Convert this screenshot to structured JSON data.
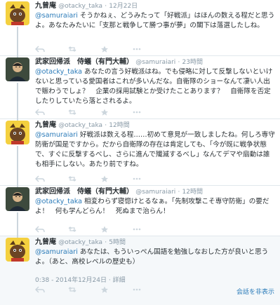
{
  "tweets": [
    {
      "name": "九曾庵",
      "screen": "@otacky_taka",
      "time": "12月22日",
      "mention": "@samuraiari",
      "text": " そうかねぇ、どうみたって「好戦派」はほんの数える程だと思うよ。あなたみたいに「支那と戦争して勝つ事が夢」の閣下は落選したしね。"
    },
    {
      "name": "武家回帰派　侍蟻（有門大輔）",
      "screen": "@samuraiari",
      "time": "23時間",
      "mention": "@otacky_taka",
      "text": " あなたの言う好戦派はね。でも侵略に対して反撃しないといけないと思っている愛国者はこれが多いんだな。自衛隊のショーなんて凄い人出で賑わうでしょ？　企業の採用試験とか受けたことあります？　自衛隊を否定したりしていたら落とされるよ。"
    },
    {
      "name": "九曾庵",
      "screen": "@otacky_taka",
      "time": "12時間",
      "mention": "@samuraiari",
      "text": " 好戦派は数える程……初めて意見が一致しましたね。何しろ専守防衛が国是ですから。だから自衛隊の存在は肯定しても、「今が既に戦争状態で、すぐに反撃するべし、さらに進んで殲滅するべし」なんてデマや扇動は誰も相手にしない。あたり前ですね。"
    },
    {
      "name": "武家回帰派　侍蟻（有門大輔）",
      "screen": "@samuraiari",
      "time": "12時間",
      "mention": "@otacky_taka",
      "text": " 相変わらず寝惚けとるなぁ。「先制攻撃こそ専守防衛」の要だよ！　何も学んどらん！　死ぬまで治らん！"
    },
    {
      "name": "九曾庵",
      "screen": "@otacky_taka",
      "time": "5時間",
      "mention": "@samuraiari",
      "text": " あなたは、もういっぺん国語を勉強しなおした方が良いと思うよ。（あと、高校レベルの歴史も）"
    }
  ],
  "footer": {
    "timestamp": "0:38 - 2014年12月24日",
    "detail": "詳細",
    "hide_link": "会話を非表示"
  },
  "icons": [
    "reply-icon",
    "retweet-icon",
    "favorite-icon",
    "more-icon"
  ],
  "colors": {
    "link": "#2b7bb9",
    "meta": "#8899a6",
    "text": "#292f33"
  }
}
